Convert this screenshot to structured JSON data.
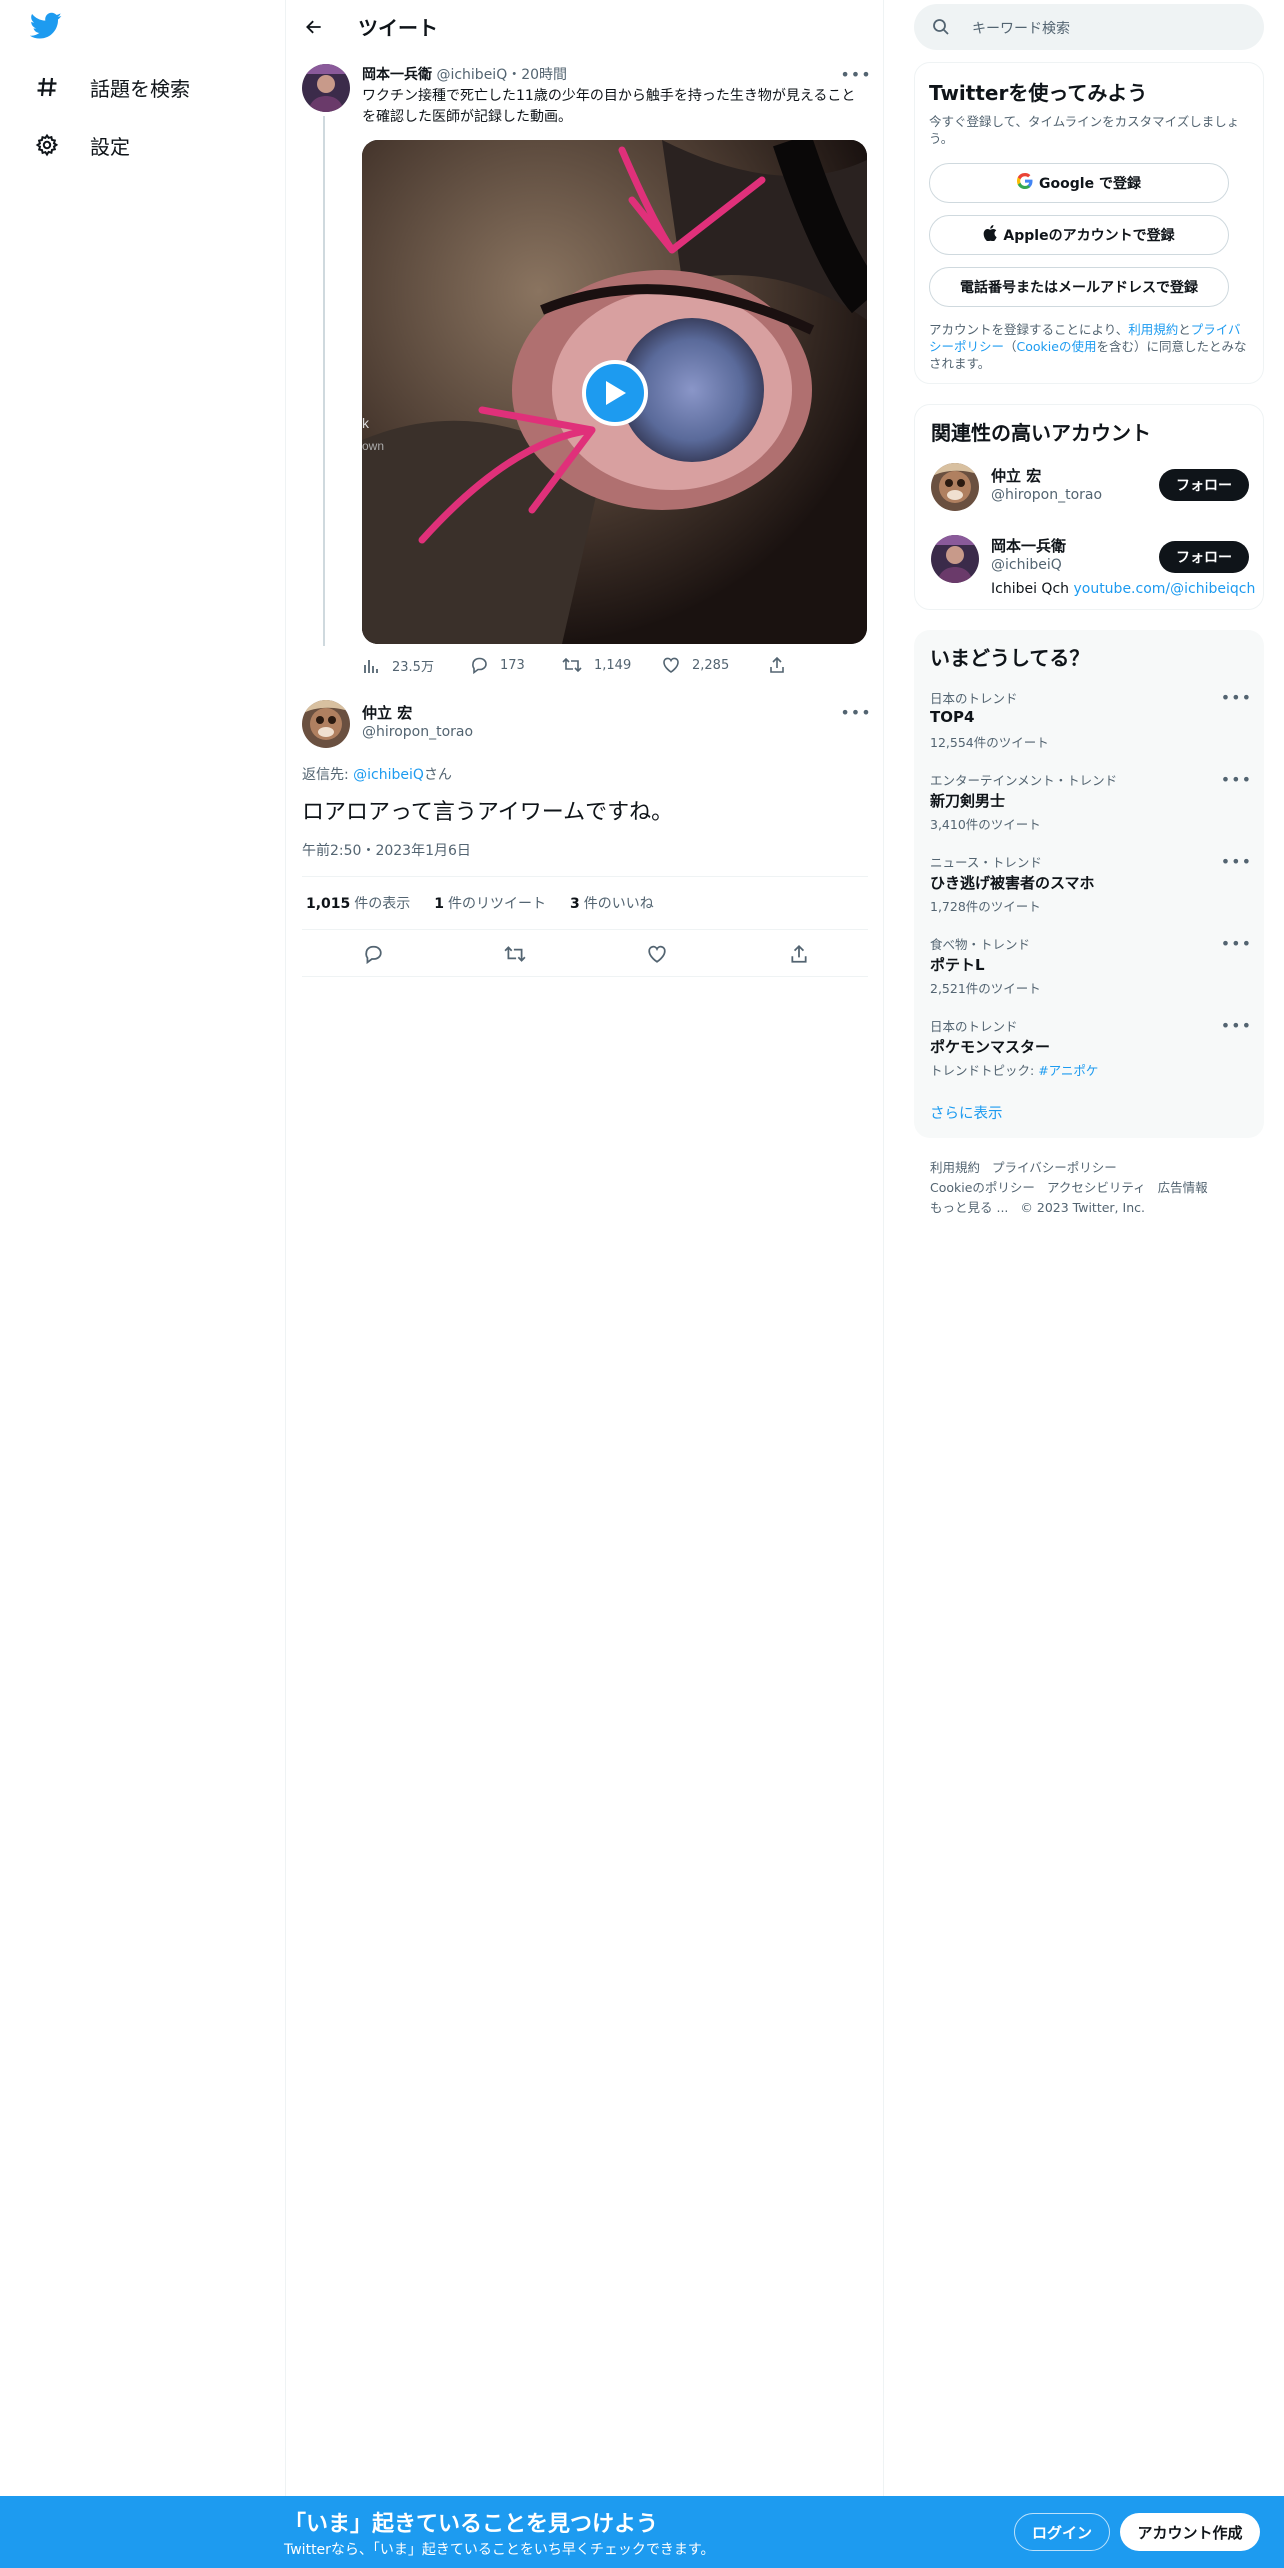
{
  "nav": {
    "logo_icon": "twitter-bird-icon",
    "items": [
      {
        "icon": "hashtag-icon",
        "label": "話題を検索"
      },
      {
        "icon": "gear-icon",
        "label": "設定"
      }
    ]
  },
  "header": {
    "title": "ツイート"
  },
  "parent_tweet": {
    "name": "岡本一兵衛",
    "handle": "@ichibeiQ",
    "time": "・20時間",
    "text": "ワクチン接種で死亡した11歳の少年の目から触手を持った生き物が見えることを確認した医師が記録した動画。",
    "media_overlay": "k own",
    "views": "23.5万",
    "replies": "173",
    "retweets": "1,149",
    "likes": "2,285"
  },
  "main_tweet": {
    "name": "仲立 宏",
    "handle": "@hiropon_torao",
    "reply_prefix": "返信先: ",
    "reply_to": "@ichibeiQ",
    "reply_suffix": "さん",
    "text": "ロアロアって言うアイワームですね。",
    "timestamp": "午前2:50・2023年1月6日",
    "views_count": "1,015",
    "views_label": "件の表示",
    "retweets_count": "1",
    "retweets_label": "件のリツイート",
    "likes_count": "3",
    "likes_label": "件のいいね"
  },
  "search": {
    "placeholder": "キーワード検索"
  },
  "signup": {
    "title": "Twitterを使ってみよう",
    "subtitle": "今すぐ登録して、タイムラインをカスタマイズしましょう。",
    "google": "Google で登録",
    "apple": "Appleのアカウントで登録",
    "phone": "電話番号またはメールアドレスで登録",
    "terms_a": "アカウントを登録することにより、",
    "terms_link1": "利用規約",
    "terms_b": "と",
    "terms_link2": "プライバシーポリシー",
    "terms_c": "（",
    "terms_link3": "Cookieの使用",
    "terms_d": "を含む）に同意したとみなされます。"
  },
  "related": {
    "title": "関連性の高いアカウント",
    "accounts": [
      {
        "name": "仲立 宏",
        "handle": "@hiropon_torao",
        "follow": "フォロー"
      },
      {
        "name": "岡本一兵衛",
        "handle": "@ichibeiQ",
        "follow": "フォロー",
        "bio_text": "Ichibei Qch ",
        "bio_link": "youtube.com/@ichibeiqch"
      }
    ]
  },
  "trends": {
    "title": "いまどうしてる？",
    "items": [
      {
        "category": "日本のトレンド",
        "name": "TOP4",
        "count": "12,554件のツイート"
      },
      {
        "category": "エンターテインメント・トレンド",
        "name": "新刀剣男士",
        "count": "3,410件のツイート"
      },
      {
        "category": "ニュース・トレンド",
        "name": "ひき逃げ被害者のスマホ",
        "count": "1,728件のツイート"
      },
      {
        "category": "食べ物・トレンド",
        "name": "ポテトL",
        "count": "2,521件のツイート"
      },
      {
        "category": "日本のトレンド",
        "name": "ポケモンマスター",
        "count_prefix": "トレンドトピック: ",
        "count_link": "#アニポケ"
      }
    ],
    "show_more": "さらに表示"
  },
  "footer": {
    "links": [
      "利用規約",
      "プライバシーポリシー",
      "Cookieのポリシー",
      "アクセシビリティ",
      "広告情報",
      "もっと見る ...",
      "© 2023 Twitter, Inc."
    ]
  },
  "banner": {
    "title": "「いま」起きていることを見つけよう",
    "subtitle": "Twitterなら、「いま」起きていることをいち早くチェックできます。",
    "login": "ログイン",
    "signup": "アカウント作成"
  },
  "colors": {
    "accent": "#1d9bf0",
    "text": "#0f1419",
    "muted": "#536471"
  }
}
